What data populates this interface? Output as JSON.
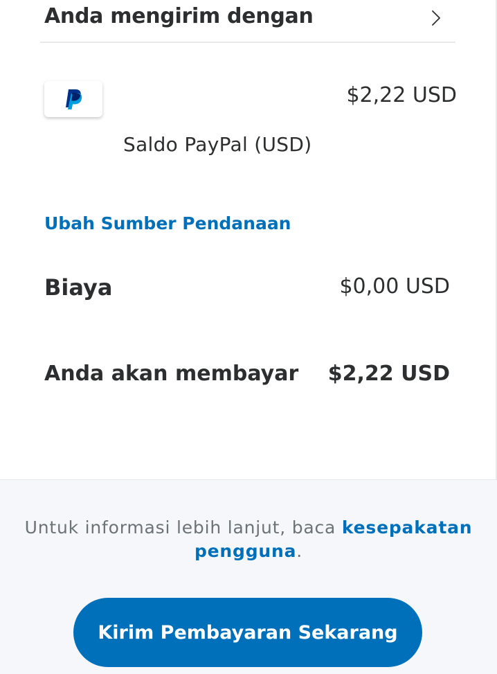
{
  "send_with": {
    "title": "Anda mengirim dengan",
    "chevron_icon": "chevron-right-icon"
  },
  "funding_source": {
    "logo_icon": "paypal-logo-icon",
    "amount": "$2,22 USD",
    "name": "Saldo PayPal (USD)"
  },
  "change_funding_link": "Ubah Sumber Pendanaan",
  "fee": {
    "label": "Biaya",
    "amount": "$0,00 USD"
  },
  "total": {
    "label": "Anda akan membayar",
    "amount": "$2,22 USD"
  },
  "info": {
    "text_before": "Untuk informasi lebih lanjut, baca ",
    "link": "kesepakatan pengguna",
    "text_after": "."
  },
  "send_button_label": "Kirim Pembayaran Sekarang",
  "colors": {
    "primary_blue": "#0070ba",
    "paypal_light_blue": "#009cde",
    "text_dark": "#2c2e2f",
    "text_muted": "#6c7378",
    "bottom_background": "#f5f7fa"
  }
}
